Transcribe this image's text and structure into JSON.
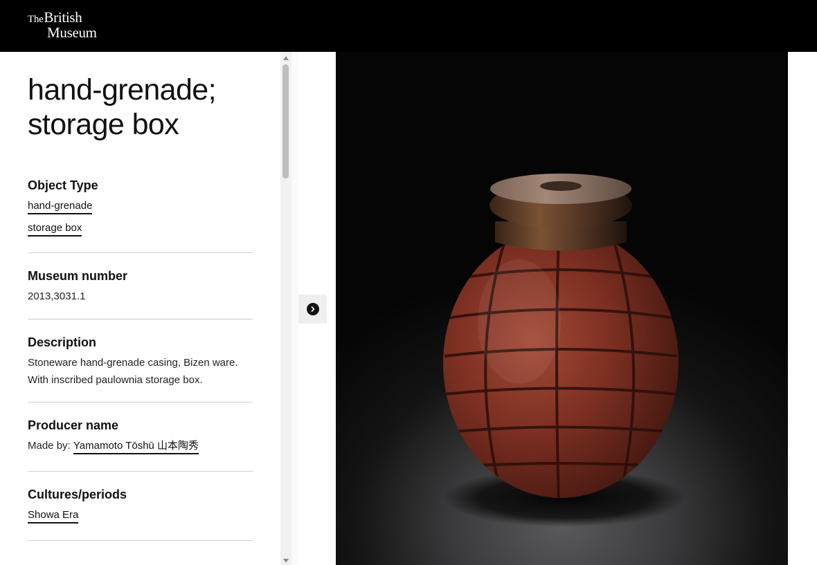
{
  "header": {
    "logo_the": "The",
    "logo_line1": "British",
    "logo_line2": "Museum"
  },
  "object": {
    "title": "hand-grenade; storage box",
    "object_type": {
      "heading": "Object Type",
      "items": [
        "hand-grenade",
        "storage box"
      ]
    },
    "museum_number": {
      "heading": "Museum number",
      "value": "2013,3031.1"
    },
    "description": {
      "heading": "Description",
      "value": "Stoneware hand-grenade casing, Bizen ware. With inscribed paulownia storage box."
    },
    "producer": {
      "heading": "Producer name",
      "prefix": "Made by: ",
      "name": "Yamamoto Tōshū 山本陶秀"
    },
    "cultures": {
      "heading": "Cultures/periods",
      "items": [
        "Showa Era"
      ]
    }
  },
  "viewer": {
    "toggle_icon": "chevron-right-icon",
    "image_subject": "stoneware-grenade-photo"
  },
  "colors": {
    "topbar": "#000000",
    "link_underline": "#111111",
    "divider": "#cfcfcf"
  }
}
